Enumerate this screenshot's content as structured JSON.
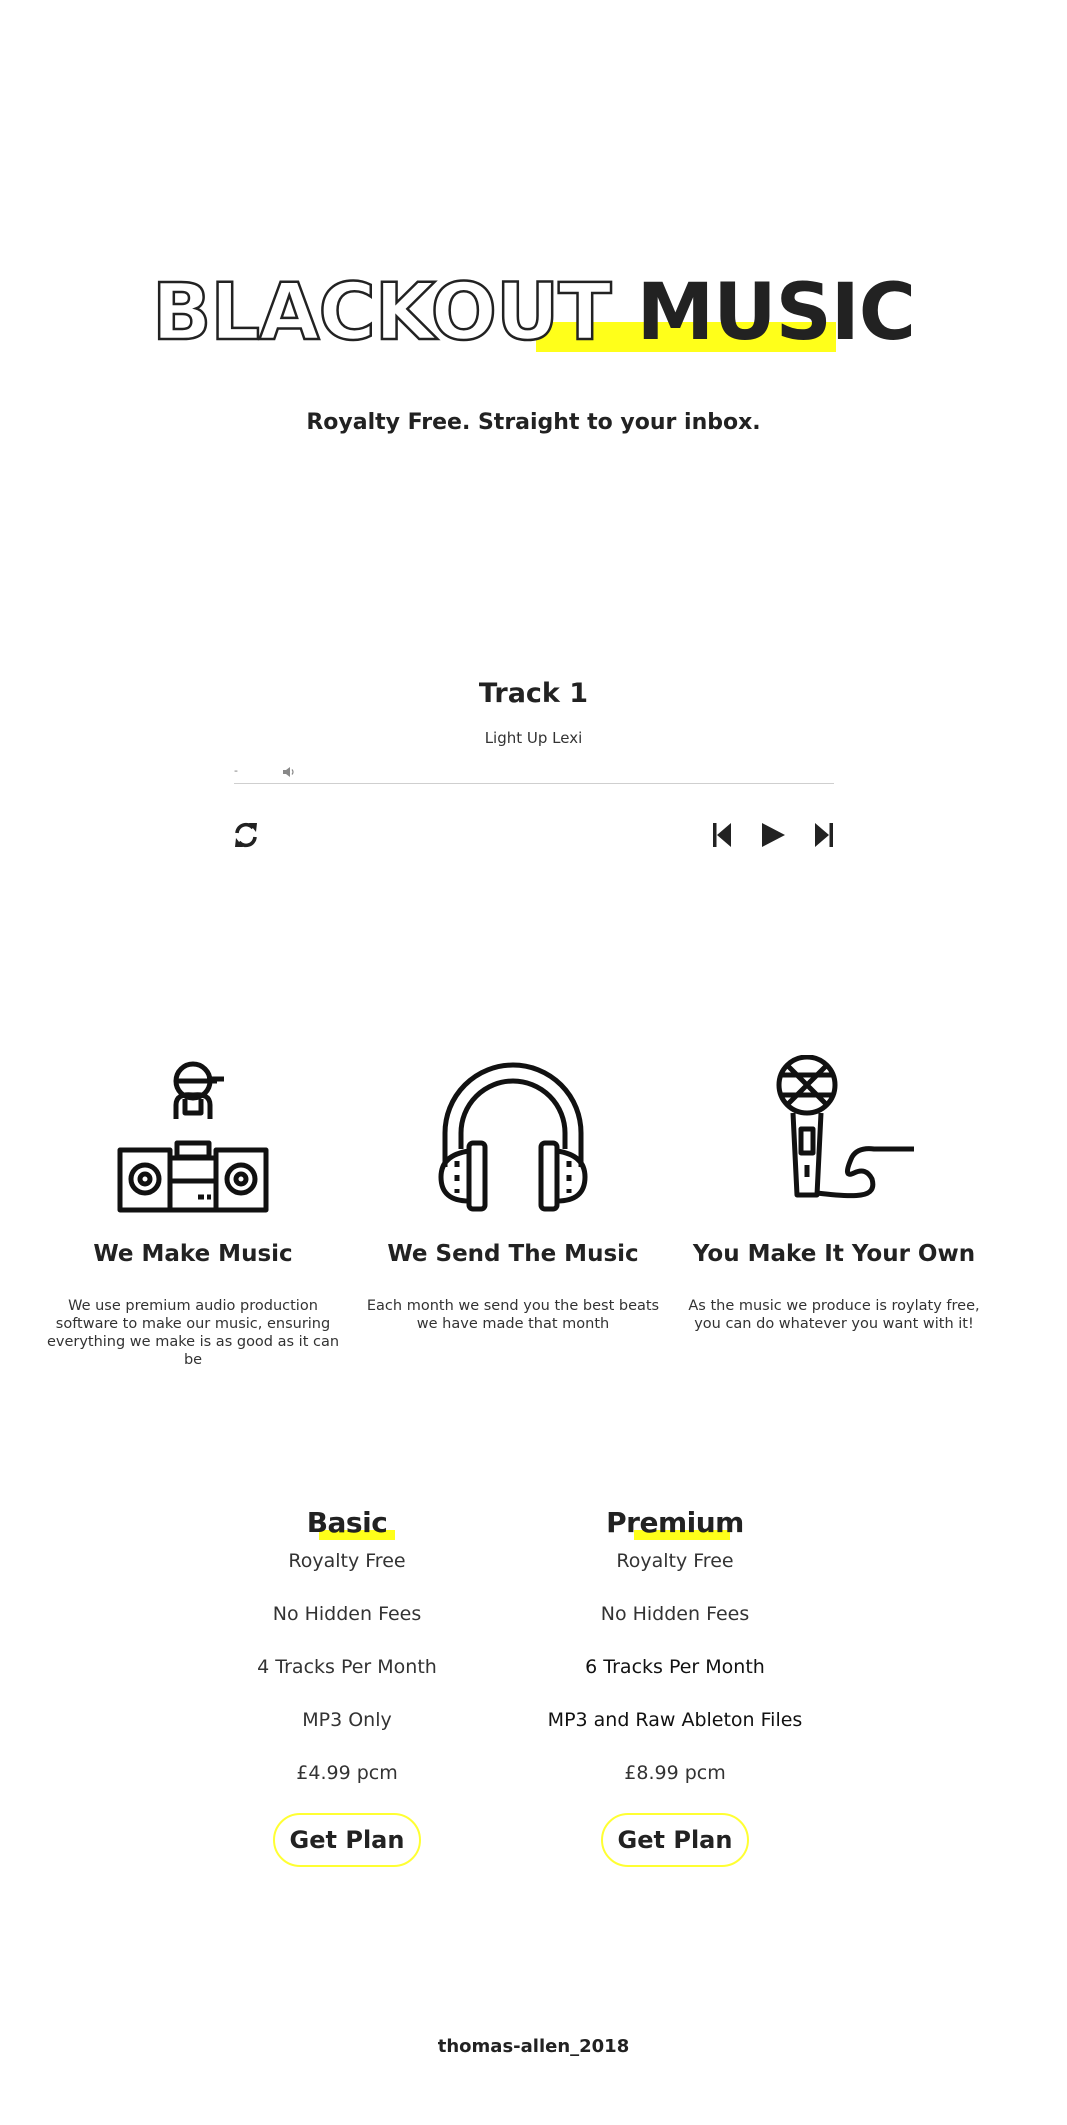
{
  "hero": {
    "title_outline": "BLACKOUT",
    "title_solid": "MUSIC",
    "subtitle": "Royalty Free. Straight to your inbox."
  },
  "player": {
    "track_title": "Track 1",
    "artist": "Light Up Lexi",
    "time": "-",
    "progress": 0,
    "icons": {
      "volume": "volume-icon",
      "repeat": "repeat-icon",
      "previous": "skip-previous-icon",
      "play": "play-icon",
      "next": "skip-next-icon"
    }
  },
  "features": [
    {
      "icon": "dj-turntables-icon",
      "title": "We Make Music",
      "text": "We use premium audio production software to make our music, ensuring everything we make is as good as it can be"
    },
    {
      "icon": "headphones-icon",
      "title": "We Send The Music",
      "text": "Each month we send you the best beats we have made that month"
    },
    {
      "icon": "microphone-icon",
      "title": "You Make It Your Own",
      "text": "As the music we produce is roylaty free, you can do whatever you want with it!"
    }
  ],
  "plans": [
    {
      "name": "Basic",
      "features": [
        "Royalty Free",
        "No Hidden Fees",
        "4 Tracks Per Month",
        "MP3 Only",
        "£4.99 pcm"
      ],
      "button": "Get Plan"
    },
    {
      "name": "Premium",
      "features": [
        "Royalty Free",
        "No Hidden Fees",
        "6 Tracks Per Month",
        "MP3 and Raw Ableton Files",
        "£8.99 pcm"
      ],
      "button": "Get Plan"
    }
  ],
  "footer": {
    "credit": "thomas-allen_2018"
  },
  "colors": {
    "accent": "#ffff1a",
    "text": "#222222",
    "background": "#ffffff"
  }
}
